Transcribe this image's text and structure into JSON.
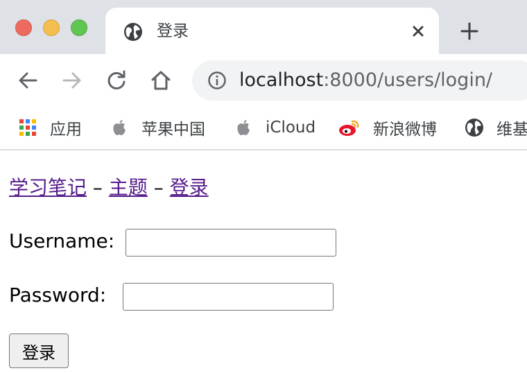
{
  "browser": {
    "tab": {
      "title": "登录",
      "favicon": "globe-icon"
    },
    "address": {
      "host": "localhost",
      "rest": ":8000/users/login/"
    },
    "bookmarks": [
      {
        "label": "应用",
        "icon": "apps-grid-icon"
      },
      {
        "label": "苹果中国",
        "icon": "apple-icon"
      },
      {
        "label": "iCloud",
        "icon": "apple-icon"
      },
      {
        "label": "新浪微博",
        "icon": "weibo-icon"
      },
      {
        "label": "维基",
        "icon": "globe-icon"
      }
    ]
  },
  "page": {
    "breadcrumb": [
      {
        "label": "学习笔记"
      },
      {
        "label": "主题"
      },
      {
        "label": "登录"
      }
    ],
    "separator": "–",
    "form": {
      "username_label": "Username:",
      "username_value": "",
      "password_label": "Password:",
      "password_value": "",
      "submit_label": "登录"
    }
  },
  "colors": {
    "tabstrip": "#dee1e6",
    "omnibox": "#f1f3f4",
    "visited_link": "#551a8b",
    "close_light": "#ed6a5e",
    "minimize_light": "#f5bf4f",
    "zoom_light": "#61c554",
    "weibo_red": "#e6162d"
  }
}
